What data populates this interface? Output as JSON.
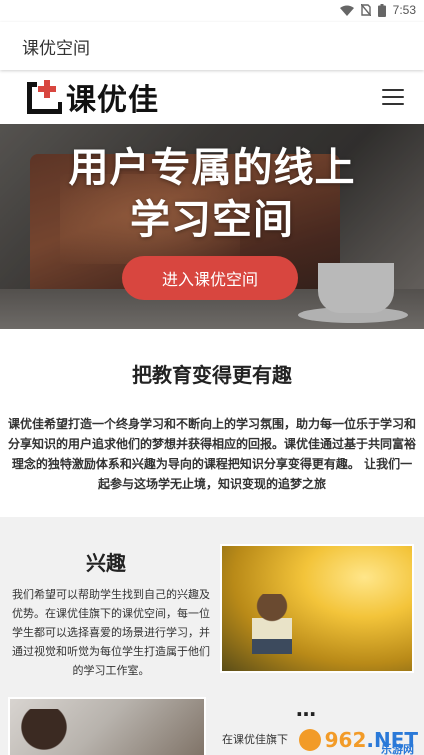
{
  "status_bar": {
    "time": "7:53",
    "icons": [
      "wifi-icon",
      "no-sim-icon",
      "battery-icon"
    ]
  },
  "app_bar": {
    "title": "课优空间"
  },
  "site_header": {
    "logo_text": "课优佳",
    "logo_colors": {
      "frame": "#111111",
      "cross": "#d8463f"
    },
    "menu_icon": "hamburger-menu-icon"
  },
  "hero": {
    "title_line1": "用户专属的线上",
    "title_line2": "学习空间",
    "cta_label": "进入课优空间",
    "cta_color": "#d8463f"
  },
  "intro": {
    "title": "把教育变得更有趣",
    "text": "课优佳希望打造一个终身学习和不断向上的学习氛围，助力每一位乐于学习和分享知识的用户追求他们的梦想并获得相应的回报。课优佳通过基于共同富裕理念的独特激励体系和兴趣为导向的课程把知识分享变得更有趣。 让我们一起参与这场学无止境，知识变现的追梦之旅"
  },
  "features": {
    "interest_title": "兴趣",
    "interest_text": "我们希望可以帮助学生找到自己的兴趣及优势。在课优佳旗下的课优空间，每一位学生都可以选择喜爱的场景进行学习，并通过视觉和听觉为每位学生打造属于他们的学习工作室。",
    "second_title": "…",
    "second_text_partial": "在课优佳旗下"
  },
  "watermark": {
    "main_a": "962",
    "main_b": ".NET",
    "sub": "乐游网"
  }
}
